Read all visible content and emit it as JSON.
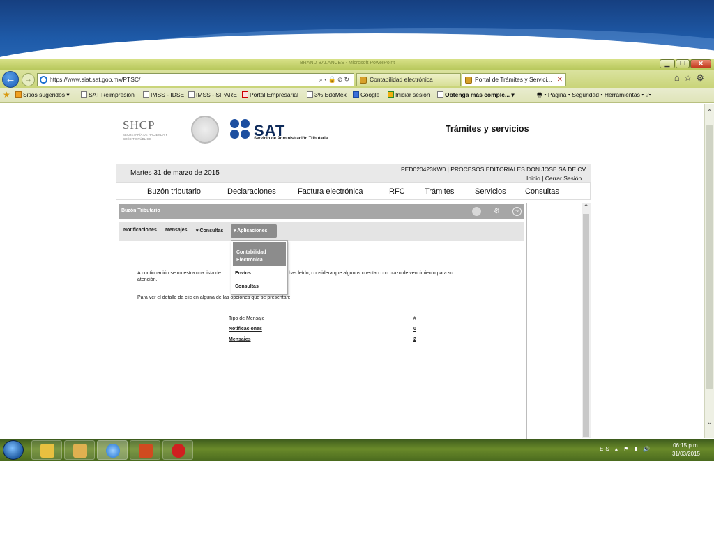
{
  "browser": {
    "title_ghost": "BRAND BALANCES - Microsoft PowerPoint",
    "url": "https://www.siat.sat.gob.mx/PTSC/",
    "tabs": [
      {
        "label": "Contabilidad electrónica"
      },
      {
        "label": "Portal de Trámites y Servici..."
      }
    ],
    "favorites": [
      "Sitios sugeridos ▾",
      "SAT Reimpresión",
      "IMSS - IDSE",
      "IMSS - SIPARE",
      "Portal Empresarial",
      "3% EdoMex",
      "Google",
      "Iniciar sesión",
      "Obtenga más comple... ▾"
    ],
    "fav_right": "Página ▾   Seguridad ▾   Herramientas ▾"
  },
  "header": {
    "shcp": "SHCP",
    "shcp_sub": "SECRETARÍA DE HACIENDA Y CRÉDITO PÚBLICO",
    "sat": "SAT",
    "sat_sub": "Servicio de Administración Tributaria",
    "section_title": "Trámites y servicios"
  },
  "info": {
    "date": "Martes 31 de marzo de 2015",
    "rfc_name": "PED020423KW0 | PROCESOS EDITORIALES DON JOSE SA DE CV",
    "links": "Inicio | Cerrar Sesión"
  },
  "main_nav": [
    "Buzón tributario",
    "Declaraciones",
    "Factura electrónica",
    "RFC",
    "Trámites",
    "Servicios",
    "Consultas"
  ],
  "panel": {
    "title": "Buzón Tributario",
    "subnav": {
      "notificaciones": "Notificaciones",
      "mensajes": "Mensajes",
      "consultas": "▾ Consultas",
      "aplicaciones": "▾ Aplicaciones"
    },
    "dropdown": [
      "Contabilidad Electrónica",
      "Envíos",
      "Consultas"
    ],
    "intro": "A continuación se muestra una lista de ████████████████ que no has leído, considera que algunos cuentan con plazo de vencimiento para su atención.",
    "intro_left": "A continuación se muestra una lista de",
    "intro_right": "que no has leído, considera que algunos cuentan con plazo de vencimiento para su",
    "intro_line2": "atención.",
    "instruction": "Para ver el detalle da clic en alguna de las opciones que se presentan:",
    "table": {
      "head": [
        "Tipo de Mensaje",
        "#"
      ],
      "rows": [
        {
          "label": "Notificaciones",
          "count": "0"
        },
        {
          "label": "Mensajes",
          "count": "2"
        }
      ]
    }
  },
  "taskbar": {
    "lang": "ES",
    "time": "06:15 p.m.",
    "date": "31/03/2015"
  }
}
